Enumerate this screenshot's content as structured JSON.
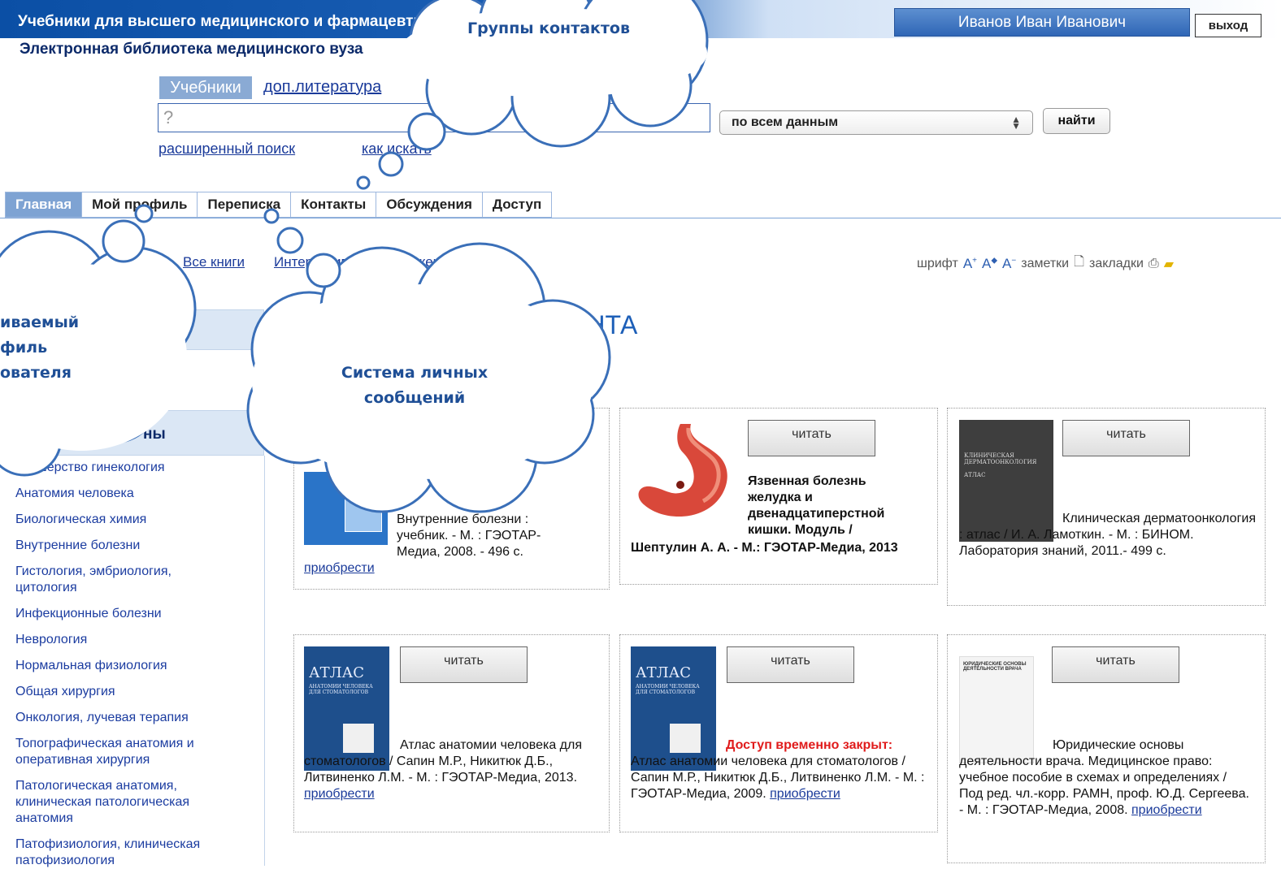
{
  "header": {
    "site_title": "Учебники для высшего медицинского и фармацевтического образования",
    "site_subtitle": "Электронная библиотека медицинского вуза",
    "user_name": "Иванов Иван Иванович",
    "logout_label": "выход"
  },
  "search": {
    "tab_active": "Учебники",
    "tab_other": "доп.литература",
    "input_value": "?",
    "scope_selected": "по всем данным",
    "submit_label": "найти",
    "advanced_link": "расширенный поиск",
    "howto_link": "как искать"
  },
  "nav": {
    "tabs": [
      "Главная",
      "Мой профиль",
      "Переписка",
      "Контакты",
      "Обсуждения",
      "Доступ"
    ]
  },
  "subnav": {
    "all_books": "Все книги",
    "interactive_apps": "Интерактивные приложения",
    "tools": {
      "font": "шрифт",
      "notes": "заметки",
      "bookmarks": "закладки"
    }
  },
  "main": {
    "page_title": "ЕНТА"
  },
  "sidebar": {
    "heading": "ны",
    "subjects": [
      "Акушерство гинекология",
      "Анатомия человека",
      "Биологическая химия",
      "Внутренние болезни",
      "Гистология, эмбриология, цитология",
      "Инфекционные болезни",
      "Неврология",
      "Нормальная физиология",
      "Общая хирургия",
      "Онкология, лучевая терапия",
      "Топографическая анатомия и оперативная хирургия",
      "Патологическая анатомия, клиническая патологическая анатомия",
      "Патофизиология, клиническая патофизиология"
    ]
  },
  "books": {
    "read_label": "читать",
    "buy_label": "приобрести",
    "b1": {
      "text": "Внутренние болезни : учебник. - М. : ГЭОТАР-Медиа, 2008. - 496 с."
    },
    "b2": {
      "title": "Язвенная болезнь желудка и двенадцатиперстной кишки. Модуль /",
      "author": "Шептулин А. А. - М.: ГЭОТАР-Медиа, 2013"
    },
    "b3": {
      "text": "Клиническая дерматоонкология : атлас / И. А. Ламоткин. - М. : БИНОМ. Лаборатория знаний, 2011.- 499 с."
    },
    "b4": {
      "text": "Атлас анатомии человека для стоматологов / Сапин М.Р., Никитюк Д.Б., Литвиненко Л.М. - М. : ГЭОТАР-Медиа, 2013."
    },
    "b5": {
      "closed": "Доступ временно закрыт:",
      "text": "Атлас анатомии человека для стоматологов / Сапин М.Р., Никитюк Д.Б., Литвиненко Л.М. - М. : ГЭОТАР-Медиа, 2009."
    },
    "b6": {
      "text": "Юридические основы деятельности врача. Медицинское право: учебное пособие в схемах и определениях / Под ред. чл.-корр. РАМН, проф. Ю.Д. Сергеева. - М. : ГЭОТАР-Медиа, 2008."
    }
  },
  "covers": {
    "atlas_title": "АТЛАС",
    "atlas_sub": "АНАТОМИИ ЧЕЛОВЕКА ДЛЯ СТОМАТОЛОГОВ",
    "derm_title": "КЛИНИЧЕСКАЯ ДЕРМАТООНКОЛОГИЯ",
    "derm_sub": "АТЛАС",
    "law_title": "ЮРИДИЧЕСКИЕ ОСНОВЫ ДЕЯТЕЛЬНОСТИ ВРАЧА"
  },
  "callouts": {
    "contacts": "Группы контактов",
    "messages_line1": "Система личных",
    "messages_line2": "сообщений",
    "profile_line1": "ивaемый",
    "profile_line2": "филь",
    "profile_line3": "ователя"
  }
}
